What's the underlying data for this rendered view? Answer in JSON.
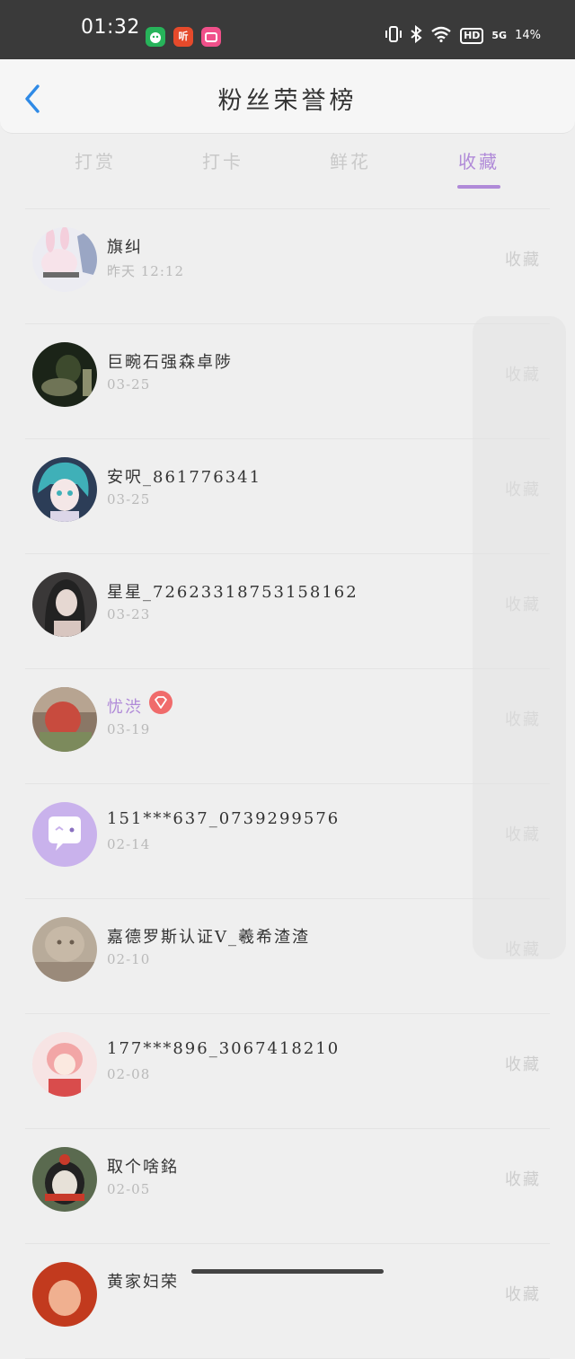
{
  "status_bar": {
    "time": "01:32",
    "apps": [
      {
        "name": "green-app-icon",
        "glyph": "",
        "color": "#27b35a"
      },
      {
        "name": "listen-app-icon",
        "glyph": "听",
        "color": "#e64a2b"
      },
      {
        "name": "pink-app-icon",
        "glyph": "",
        "color": "#f0508a"
      }
    ],
    "network": "5G",
    "hd": "HD",
    "battery": "14%"
  },
  "header": {
    "title": "粉丝荣誉榜"
  },
  "tabs": [
    {
      "label": "打赏",
      "active": false
    },
    {
      "label": "打卡",
      "active": false
    },
    {
      "label": "鲜花",
      "active": false
    },
    {
      "label": "收藏",
      "active": true
    }
  ],
  "list": [
    {
      "name": "旗纠",
      "date": "昨天 12:12",
      "action": "收藏",
      "avatar_colors": [
        "#f3d9e3",
        "#e3e3f0",
        "#9aa6c4"
      ]
    },
    {
      "name": "巨畹石强森卓陟",
      "date": "03-25",
      "action": "收藏",
      "avatar_colors": [
        "#1b2418",
        "#3d4a2d",
        "#8c8f6e"
      ]
    },
    {
      "name": "安呎_861776341",
      "date": "03-25",
      "action": "收藏",
      "avatar_colors": [
        "#2c3d57",
        "#3fb0b8",
        "#dcd6e8"
      ]
    },
    {
      "name": "星星_72623318753158162",
      "date": "03-23",
      "action": "收藏",
      "avatar_colors": [
        "#2a2a2a",
        "#4b4646",
        "#d8c6c0"
      ]
    },
    {
      "name": "忧渋",
      "date": "03-19",
      "action": "收藏",
      "avatar_colors": [
        "#9a6b5a",
        "#c84b3e",
        "#7c8a5c"
      ],
      "vip": true
    },
    {
      "name": "151***637_0739299576",
      "date": "02-14",
      "action": "收藏",
      "avatar_colors": [
        "#c9b2ec",
        "#c9b2ec",
        "#ffffff"
      ]
    },
    {
      "name": "嘉德罗斯认证V_羲希渣渣",
      "date": "02-10",
      "action": "收藏",
      "avatar_colors": [
        "#c7b9a7",
        "#9a8a7a",
        "#6b5d4f"
      ]
    },
    {
      "name": "177***896_3067418210",
      "date": "02-08",
      "action": "收藏",
      "avatar_colors": [
        "#f6d6d6",
        "#f2a6a6",
        "#d94c4c"
      ]
    },
    {
      "name": "取个啥銘",
      "date": "02-05",
      "action": "收藏",
      "avatar_colors": [
        "#5a6a4f",
        "#e7e1d8",
        "#c83a2a"
      ]
    },
    {
      "name": "黄家妇荣",
      "date": "",
      "action": "收藏",
      "avatar_colors": [
        "#c23a1e",
        "#f0b090",
        "#7a3a20"
      ]
    }
  ]
}
